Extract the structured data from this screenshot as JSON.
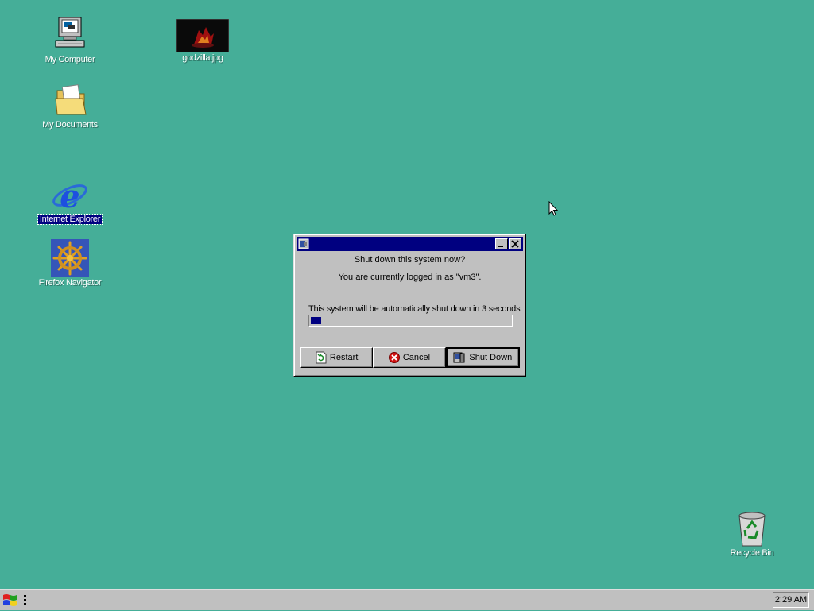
{
  "desktop": {
    "icons": [
      {
        "label": "My Computer",
        "icon": "my-computer-icon"
      },
      {
        "label": "godzilla.jpg",
        "icon": "jpeg-thumbnail-icon"
      },
      {
        "label": "My Documents",
        "icon": "folder-icon"
      },
      {
        "label": "Internet Explorer",
        "icon": "internet-explorer-icon",
        "selected": true
      },
      {
        "label": "Firefox Navigator",
        "icon": "ship-wheel-icon"
      },
      {
        "label": "Recycle Bin",
        "icon": "recycle-bin-icon"
      }
    ],
    "background_color": "#45AE98"
  },
  "dialog": {
    "question": "Shut down this system now?",
    "login_info": "You are currently logged in as \"vm3\".",
    "countdown_text": "This system will be automatically shut down in 3 seconds",
    "progress": 0.05,
    "buttons": {
      "restart": "Restart",
      "cancel": "Cancel",
      "shutdown": "Shut Down"
    },
    "titlebar_color": "#000080"
  },
  "taskbar": {
    "clock": "2:29 AM"
  }
}
